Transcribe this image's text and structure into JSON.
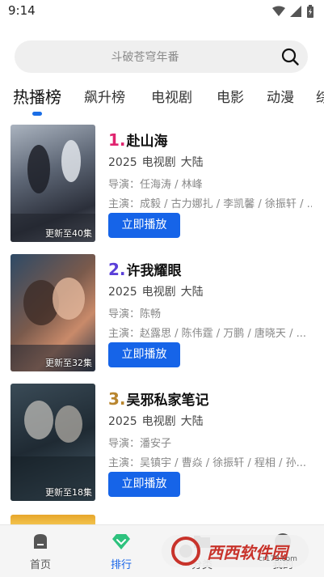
{
  "status": {
    "time": "9:14"
  },
  "search": {
    "placeholder": "斗破苍穹年番"
  },
  "tabs": [
    {
      "label": "热播榜",
      "active": true
    },
    {
      "label": "飙升榜"
    },
    {
      "label": "电视剧"
    },
    {
      "label": "电影"
    },
    {
      "label": "动漫"
    },
    {
      "label": "综"
    }
  ],
  "items": [
    {
      "rank": "1.",
      "rank_color": "#e0246f",
      "title": "赴山海",
      "year": "2025",
      "type": "电视剧",
      "region": "大陆",
      "director": "导演：任海涛 / 林峰",
      "cast": "主演：成毅 / 古力娜扎 / 李凯馨 / 徐振轩 / ...",
      "caption": "更新至40集",
      "play": "立即播放"
    },
    {
      "rank": "2.",
      "rank_color": "#5a3fd8",
      "title": "许我耀眼",
      "year": "2025",
      "type": "电视剧",
      "region": "大陆",
      "director": "导演：陈畅",
      "cast": "主演：赵露思 / 陈伟霆 / 万鹏 / 唐晓天 / ...",
      "caption": "更新至32集",
      "play": "立即播放"
    },
    {
      "rank": "3.",
      "rank_color": "#b8852e",
      "title": "吴邪私家笔记",
      "year": "2025",
      "type": "电视剧",
      "region": "大陆",
      "director": "导演：潘安子",
      "cast": "主演：吴镇宇 / 曹焱 / 徐振轩 / 程相 / 孙...",
      "caption": "更新至18集",
      "play": "立即播放"
    }
  ],
  "nav": [
    {
      "label": "首页"
    },
    {
      "label": "排行",
      "active": true
    },
    {
      "label": "分类"
    },
    {
      "label": "我的"
    }
  ],
  "watermark": {
    "text": "西西软件园",
    "url": "cr173.com"
  },
  "colors": {
    "accent": "#1664e8",
    "active_nav_icon": "#2ec27e"
  }
}
